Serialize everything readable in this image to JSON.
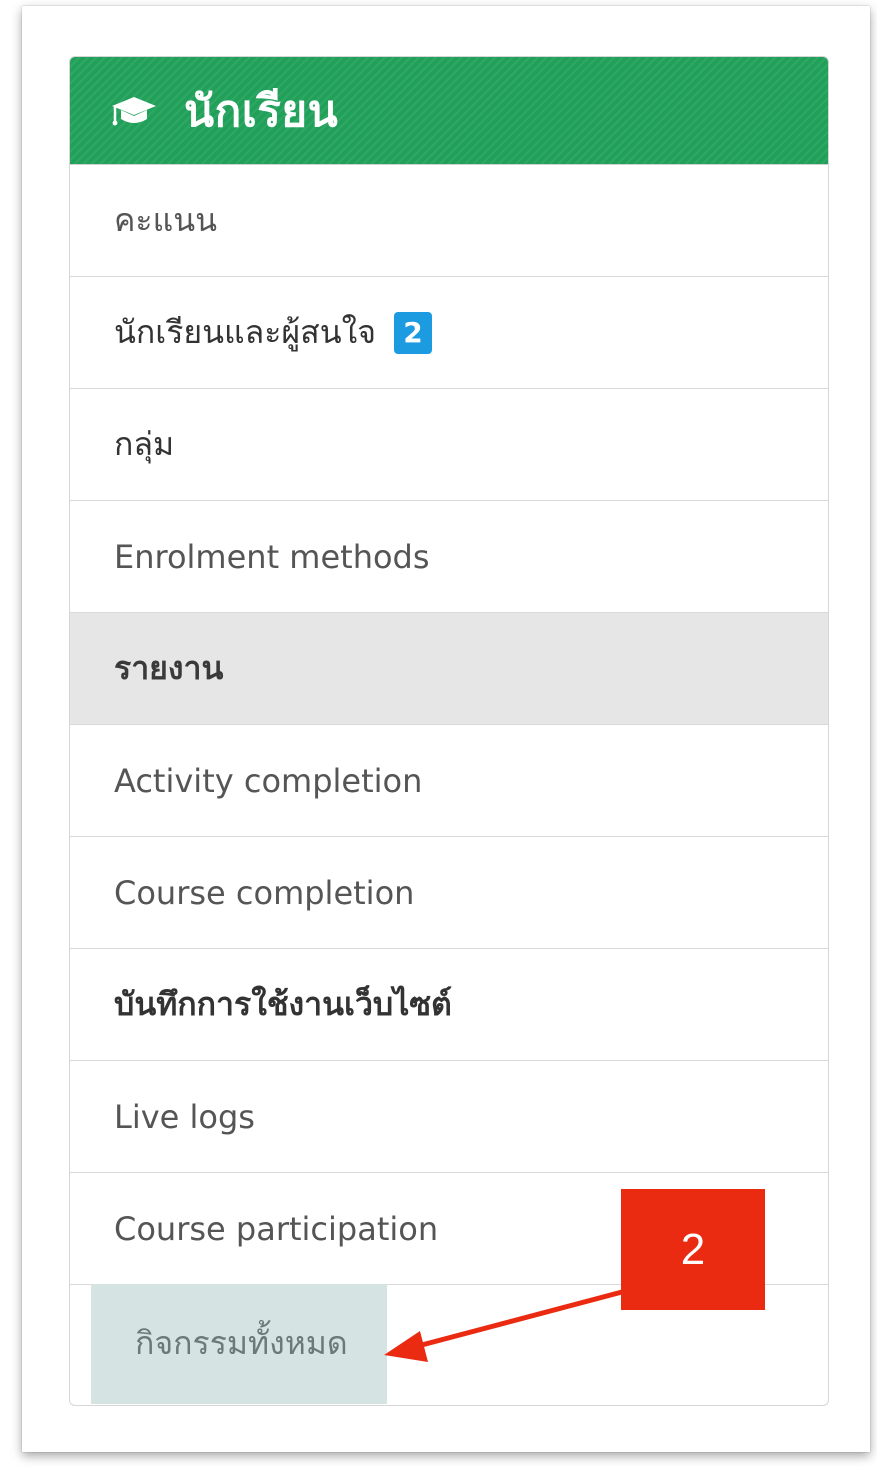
{
  "panel": {
    "title": "นักเรียน",
    "header_icon": "graduation-cap-icon",
    "header_color": "#21a05a"
  },
  "menu": {
    "scores": "คะแนน",
    "students_interested": "นักเรียนและผู้สนใจ",
    "students_badge": "2",
    "groups": "กลุ่ม",
    "enrolment_methods": "Enrolment methods",
    "reports_section": "รายงาน",
    "activity_completion": "Activity completion",
    "course_completion": "Course completion",
    "site_logs": "บันทึกการใช้งานเว็บไซต์",
    "live_logs": "Live logs",
    "course_participation": "Course participation",
    "all_activities": "กิจกรรมทั้งหมด"
  },
  "annotation": {
    "step_number": "2",
    "color": "#ea2b12"
  }
}
